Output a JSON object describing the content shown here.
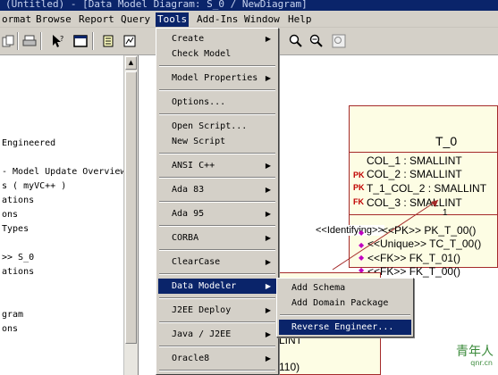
{
  "window": {
    "title": "(Untitled) - [Data Model Diagram: S_0 / NewDiagram]"
  },
  "menubar": {
    "items": [
      {
        "label": "ormat"
      },
      {
        "label": "Browse"
      },
      {
        "label": "Report"
      },
      {
        "label": "Query"
      },
      {
        "label": "Tools"
      },
      {
        "label": "Add-Ins"
      },
      {
        "label": "Window"
      },
      {
        "label": "Help"
      }
    ]
  },
  "toolbar": {
    "icons": [
      "copy-icon",
      "print-icon",
      "pointer-help-icon",
      "browser-icon",
      "notes-icon",
      "diagram-icon",
      "zoom-in-icon",
      "zoom-out-icon",
      "fit-icon"
    ]
  },
  "browser": {
    "lines": [
      "Engineered",
      "- Model Update Overview",
      "s ( myVC++ )",
      "ations",
      "ons",
      "Types",
      ">> S_0",
      "ations",
      "gram",
      "ons"
    ]
  },
  "tools_menu": {
    "items": [
      {
        "label": "Create",
        "has_submenu": true
      },
      {
        "label": "Check Model",
        "has_submenu": false
      },
      {
        "label": "Model Properties",
        "has_submenu": true
      },
      {
        "label": "Options...",
        "has_submenu": false
      },
      {
        "label": "Open Script...",
        "has_submenu": false
      },
      {
        "label": "New Script",
        "has_submenu": false
      },
      {
        "label": "ANSI C++",
        "has_submenu": true
      },
      {
        "label": "Ada 83",
        "has_submenu": true
      },
      {
        "label": "Ada 95",
        "has_submenu": true
      },
      {
        "label": "CORBA",
        "has_submenu": true
      },
      {
        "label": "ClearCase",
        "has_submenu": true
      },
      {
        "label": "Data Modeler",
        "has_submenu": true,
        "highlighted": true
      },
      {
        "label": "J2EE Deploy",
        "has_submenu": true
      },
      {
        "label": "Java / J2EE",
        "has_submenu": true
      },
      {
        "label": "Oracle8",
        "has_submenu": true
      },
      {
        "label": "",
        "has_submenu": true
      }
    ]
  },
  "data_modeler_submenu": {
    "items": [
      {
        "label": "Add Schema"
      },
      {
        "label": "Add Domain Package"
      },
      {
        "label": "Reverse Engineer...",
        "highlighted": true
      }
    ]
  },
  "entity": {
    "name": "T_0",
    "columns": [
      {
        "key": "",
        "text": "COL_1 : SMALLINT"
      },
      {
        "key": "PK",
        "text": "COL_2 : SMALLINT"
      },
      {
        "key": "PK",
        "text": "T_1_COL_2 : SMALLINT"
      },
      {
        "key": "FK",
        "text": "COL_3 : SMALLINT"
      }
    ],
    "multiplicity": "1",
    "relationship_label": "<<Identifying>>",
    "operations": [
      "<<PK>> PK_T_00()",
      "<<Unique>> TC_T_00()",
      "<<FK>> FK_T_01()",
      "<<FK>> FK_T_00()"
    ]
  },
  "entity2": {
    "lines": [
      "LINT",
      "110)"
    ]
  },
  "watermark": {
    "line1": "青年人",
    "line2": "qnr.cn"
  },
  "colors": {
    "menu_highlight": "#0a246a",
    "entity_fill": "#fdfde4",
    "entity_border": "#a52a2a",
    "key_text": "#c00000",
    "operation_icon": "#c000c0"
  }
}
